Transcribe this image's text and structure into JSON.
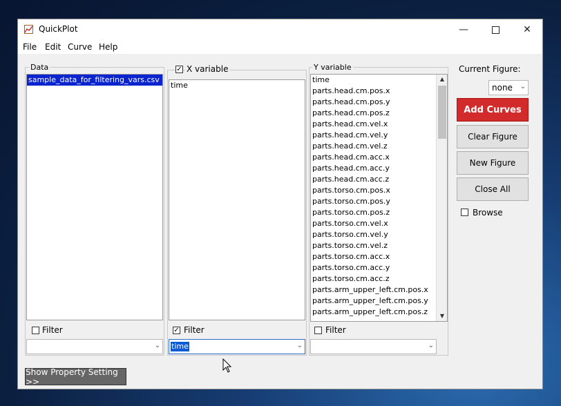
{
  "window": {
    "title": "QuickPlot"
  },
  "menu": [
    "File",
    "Edit",
    "Curve",
    "Help"
  ],
  "data_panel": {
    "label": "Data",
    "items": [
      "sample_data_for_filtering_vars.csv"
    ],
    "selected_index": 0,
    "filter_label": "Filter",
    "filter_checked": false,
    "combo_value": ""
  },
  "x_panel": {
    "label": "X variable",
    "header_checked": true,
    "items": [
      "time"
    ],
    "filter_label": "Filter",
    "filter_checked": true,
    "combo_value": "time"
  },
  "y_panel": {
    "label": "Y variable",
    "items": [
      "time",
      "parts.head.cm.pos.x",
      "parts.head.cm.pos.y",
      "parts.head.cm.pos.z",
      "parts.head.cm.vel.x",
      "parts.head.cm.vel.y",
      "parts.head.cm.vel.z",
      "parts.head.cm.acc.x",
      "parts.head.cm.acc.y",
      "parts.head.cm.acc.z",
      "parts.torso.cm.pos.x",
      "parts.torso.cm.pos.y",
      "parts.torso.cm.pos.z",
      "parts.torso.cm.vel.x",
      "parts.torso.cm.vel.y",
      "parts.torso.cm.vel.z",
      "parts.torso.cm.acc.x",
      "parts.torso.cm.acc.y",
      "parts.torso.cm.acc.z",
      "parts.arm_upper_left.cm.pos.x",
      "parts.arm_upper_left.cm.pos.y",
      "parts.arm_upper_left.cm.pos.z"
    ],
    "filter_label": "Filter",
    "filter_checked": false,
    "combo_value": ""
  },
  "right_panel": {
    "current_figure_label": "Current Figure:",
    "figure_value": "none",
    "buttons": {
      "add_curves": "Add Curves",
      "clear_figure": "Clear Figure",
      "new_figure": "New Figure",
      "close_all": "Close All"
    },
    "browse_label": "Browse",
    "browse_checked": false
  },
  "footer": {
    "show_property": "Show Property Setting >>"
  },
  "colors": {
    "accent_red": "#d22b2b",
    "selection_blue": "#0a24d0"
  },
  "icons": {
    "app": "chart-icon",
    "minimize": "minimize-icon",
    "maximize": "maximize-icon",
    "close": "close-icon"
  }
}
